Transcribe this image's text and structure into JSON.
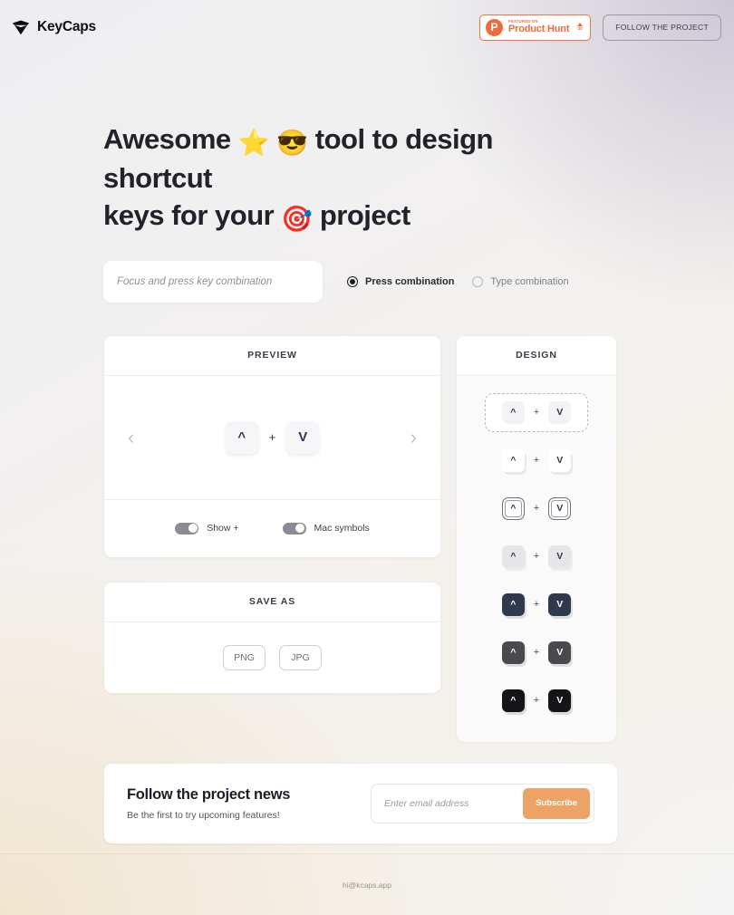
{
  "header": {
    "brand": {
      "name": "KeyCaps",
      "icon": "diamond-icon"
    },
    "product_hunt": {
      "featured_label": "FEATURED ON",
      "name": "Product Hunt",
      "logo_letter": "P",
      "vote_count": "20",
      "accent_color": "#ef6a3d"
    },
    "follow_button": "FOLLOW THE PROJECT"
  },
  "hero": {
    "line1_a": "Awesome",
    "emoji_star": "⭐",
    "emoji_cool": "😎",
    "line1_b": "tool to design shortcut",
    "line2_a": "keys for your",
    "emoji_target": "🎯",
    "line2_b": "project"
  },
  "controls": {
    "input_placeholder": "Focus and press key combination",
    "input_value": "",
    "options": [
      {
        "label": "Press combination",
        "selected": true
      },
      {
        "label": "Type combination",
        "selected": false
      }
    ]
  },
  "preview": {
    "heading": "PREVIEW",
    "prev_icon": "chevron-left-icon",
    "next_icon": "chevron-right-icon",
    "keys": [
      "^",
      "V"
    ],
    "separator": "+",
    "toggles": [
      {
        "label": "Show +",
        "on": true
      },
      {
        "label": "Mac symbols",
        "on": true
      }
    ]
  },
  "save_as": {
    "heading": "SAVE AS",
    "formats": [
      "PNG",
      "JPG"
    ]
  },
  "design": {
    "heading": "DESIGN",
    "separator": "+",
    "keys": [
      "^",
      "V"
    ],
    "variants": [
      {
        "style": "dk-flat",
        "selected": true
      },
      {
        "style": "dk-3d",
        "selected": false
      },
      {
        "style": "dk-outline",
        "selected": false
      },
      {
        "style": "dk-gray",
        "selected": false
      },
      {
        "style": "dk-navy",
        "selected": false
      },
      {
        "style": "dk-dgray",
        "selected": false
      },
      {
        "style": "dk-black",
        "selected": false
      }
    ]
  },
  "newsletter": {
    "title": "Follow the project news",
    "subtitle": "Be the first to try upcoming features!",
    "email_placeholder": "Enter email address",
    "email_value": "",
    "submit_label": "Subscribe",
    "accent_color": "#eda365"
  },
  "footer": {
    "email": "hi@kcaps.app"
  }
}
